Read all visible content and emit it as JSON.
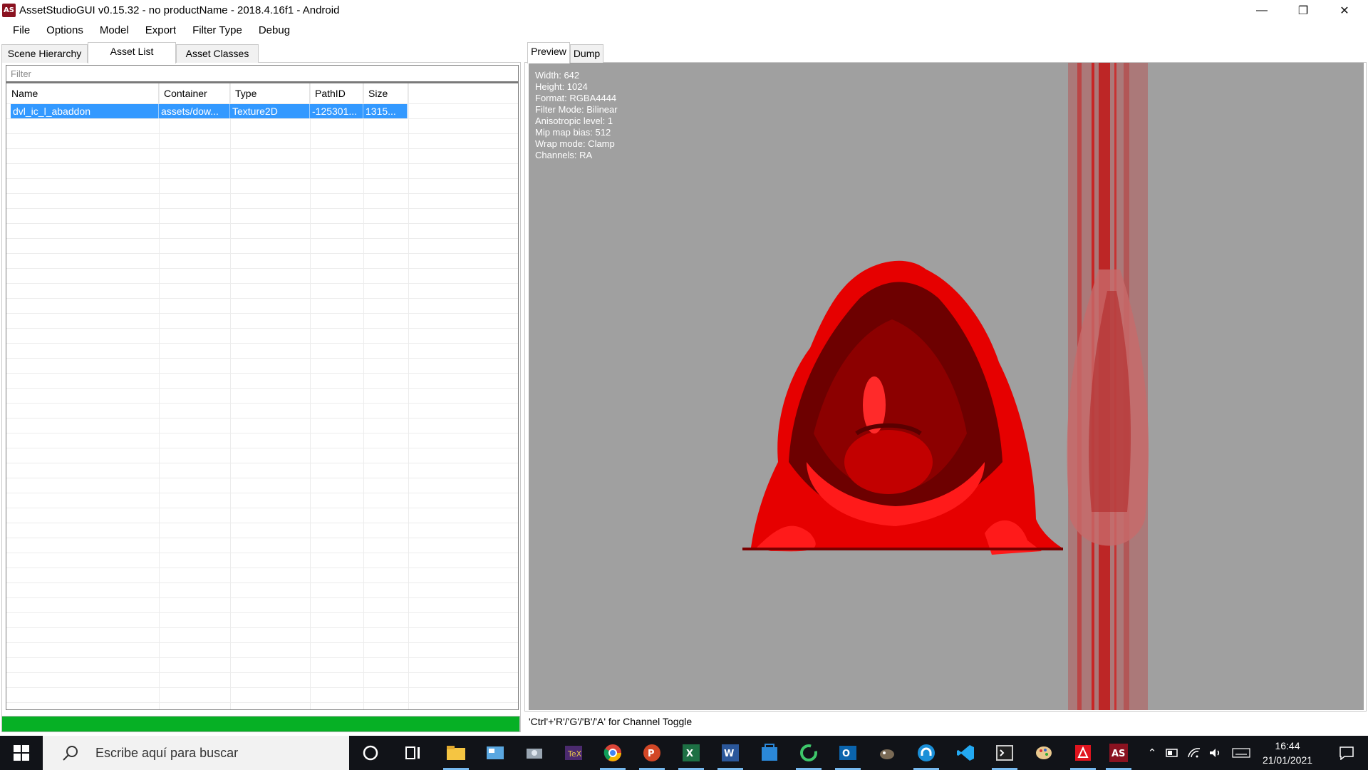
{
  "window": {
    "icon_text": "AS",
    "title": "AssetStudioGUI v0.15.32 - no productName - 2018.4.16f1 - Android",
    "minimize_glyph": "—",
    "maximize_glyph": "❐",
    "close_glyph": "✕"
  },
  "menu": [
    "File",
    "Options",
    "Model",
    "Export",
    "Filter Type",
    "Debug"
  ],
  "left": {
    "tabs": [
      "Scene Hierarchy",
      "Asset List",
      "Asset Classes"
    ],
    "filter_placeholder": "Filter",
    "columns": [
      "Name",
      "Container",
      "Type",
      "PathID",
      "Size"
    ],
    "rows": [
      {
        "name": "dvl_ic_l_abaddon",
        "container": "assets/dow...",
        "type": "Texture2D",
        "pathid": "-125301...",
        "size": "1315..."
      }
    ],
    "progress": 1.0
  },
  "right": {
    "tabs": [
      "Preview",
      "Dump"
    ],
    "info": {
      "width": "Width: 642",
      "height": "Height: 1024",
      "format": "Format: RGBA4444",
      "filter_mode": "Filter Mode: Bilinear",
      "aniso": "Anisotropic level: 1",
      "mip": "Mip map bias: 512",
      "wrap": "Wrap mode: Clamp",
      "channels": "Channels: RA"
    },
    "status": "'Ctrl'+'R'/'G'/'B'/'A' for Channel Toggle"
  },
  "taskbar": {
    "search_text": "Escribe aquí para buscar",
    "time": "16:44",
    "date": "21/01/2021",
    "colors": {
      "accent": "#06b025",
      "selection": "#3399ff",
      "texture": "#e00000"
    }
  }
}
